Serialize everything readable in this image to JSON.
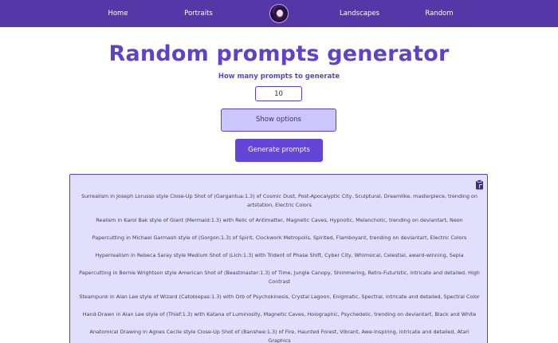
{
  "nav": {
    "home": "Home",
    "portraits": "Portraits",
    "avatar_icon": "portrait-avatar-icon",
    "landscapes": "Landscapes",
    "random": "Random"
  },
  "main": {
    "title": "Random prompts generator",
    "subtitle": "How many prompts to generate",
    "count_value": "10",
    "show_options_label": "Show options",
    "generate_label": "Generate prompts",
    "copy_icon": "clipboard-copy-icon"
  },
  "prompts": [
    "Surrealism in Joseph Lorusso style Close-Up Shot of (Gargantua:1.3) of Cosmic Dust, Post-Apocalyptic City, Sculptural, Dreamlike, masterpiece, trending on artstation, Electric Colors",
    "Realism in Karol Bak style of Giant (Mermaid:1.3) with Relic of Antimatter, Magnetic Caves, Hypnotic, Melancholic, trending on deviantart, Neon",
    "Papercutting in Michael Garmash style of (Gorgon:1.3) of Spirit, Clockwork Metropolis, Spirited, Flamboyant, trending on deviantart, Electric Colors",
    "Hyperrealism in Rebeca Saray style Medium Shot of (Lich:1.3) with Trident of Phase Shift, Cyber City, Whimsical, Celestial, award-winning, Sepia",
    "Papercutting in Bernie Wrightson style American Shot of (Beastmaster:1.3) of Time, Jungle Canopy, Shimmering, Retro-Futuristic, intricate and detailed, High Contrast",
    "Steampunk in Alan Lee style of Wizard (Catoblepas:1.3) with Orb of Psychokinesis, Crystal Lagoon, Enigmatic, Spectral, intricate and detailed, Spectral Color",
    "Hand-Drawn in Alan Lee style of (Thief:1.3) with Katana of Luminosity, Magnetic Caves, Holographic, Psychedelic, trending on deviantart, Black and White",
    "Anatomical Drawing in Agnes Cecile style Close-Up Shot of (Banshee:1.3) of Fire, Haunted Forest, Vibrant, Awe-Inspiring, intricate and detailed, Atari Graphics"
  ],
  "colors": {
    "nav_bg": "#5537a8",
    "accent": "#6142c7",
    "results_bg": "#e2dffd",
    "secondary_button": "#cbc6fb"
  }
}
